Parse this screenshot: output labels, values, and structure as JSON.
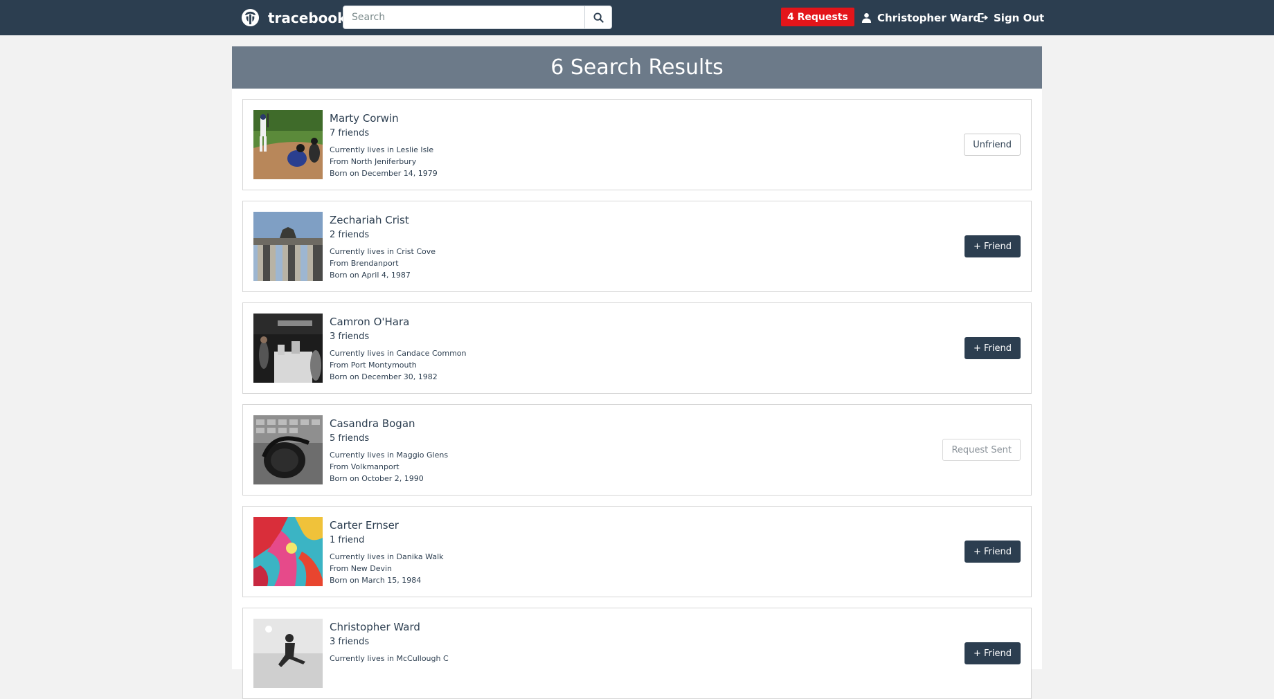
{
  "navbar": {
    "brand": "tracebook",
    "search_placeholder": "Search",
    "search_value": "",
    "requests": "4 Requests",
    "user_name": "Christopher Ward",
    "sign_out": "Sign Out"
  },
  "results": {
    "title": "6 Search Results",
    "items": [
      {
        "name": "Marty Corwin",
        "friends": "7 friends",
        "lives": "Currently lives in Leslie Isle",
        "from": "From North Jeniferbury",
        "born": "Born on December 14, 1979",
        "action": "Unfriend",
        "action_style": "outline",
        "photo": "baseball"
      },
      {
        "name": "Zechariah Crist",
        "friends": "2 friends",
        "lives": "Currently lives in Crist Cove",
        "from": "From Brendanport",
        "born": "Born on April 4, 1987",
        "action": "+ Friend",
        "action_style": "dark",
        "photo": "monument"
      },
      {
        "name": "Camron O'Hara",
        "friends": "3 friends",
        "lives": "Currently lives in Candace Common",
        "from": "From Port Montymouth",
        "born": "Born on December 30, 1982",
        "action": "+ Friend",
        "action_style": "dark",
        "photo": "store"
      },
      {
        "name": "Casandra Bogan",
        "friends": "5 friends",
        "lives": "Currently lives in Maggio Glens",
        "from": "From Volkmanport",
        "born": "Born on October 2, 1990",
        "action": "Request Sent",
        "action_style": "muted",
        "photo": "headphones"
      },
      {
        "name": "Carter Ernser",
        "friends": "1 friend",
        "lives": "Currently lives in Danika Walk",
        "from": "From New Devin",
        "born": "Born on March 15, 1984",
        "action": "+ Friend",
        "action_style": "dark",
        "photo": "paint"
      },
      {
        "name": "Christopher Ward",
        "friends": "3 friends",
        "lives": "Currently lives in McCullough C",
        "from": "",
        "born": "",
        "action": "+ Friend",
        "action_style": "dark",
        "photo": "jump"
      }
    ]
  }
}
